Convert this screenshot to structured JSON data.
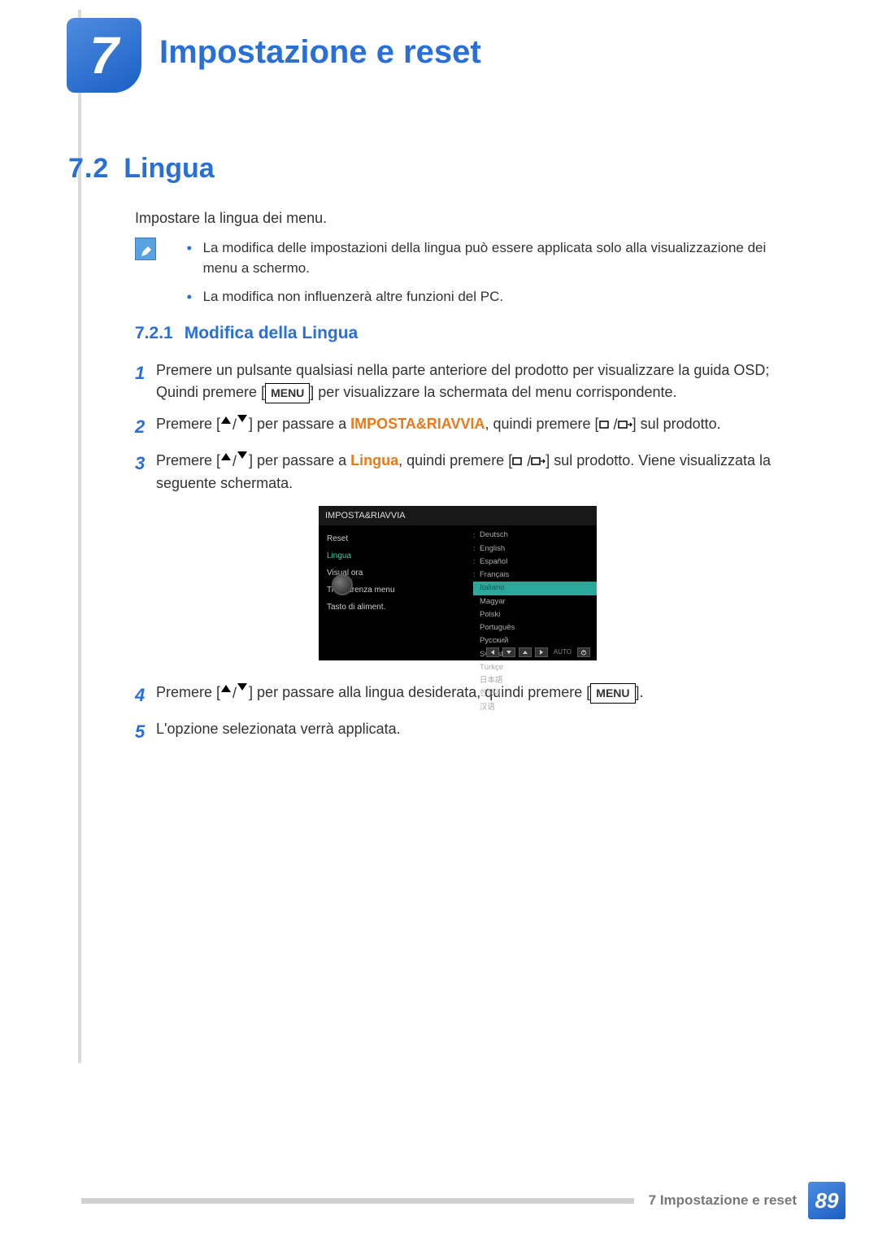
{
  "chapter": {
    "number": "7",
    "title": "Impostazione e reset"
  },
  "section": {
    "number": "7.2",
    "title": "Lingua"
  },
  "intro": "Impostare la lingua dei menu.",
  "notes": [
    "La modifica delle impostazioni della lingua può essere applicata solo alla visualizzazione dei menu a schermo.",
    "La modifica non influenzerà altre funzioni del PC."
  ],
  "subsection": {
    "number": "7.2.1",
    "title": "Modifica della Lingua"
  },
  "steps": {
    "s1a": "Premere un pulsante qualsiasi nella parte anteriore del prodotto per visualizzare la guida OSD; Quindi premere [",
    "s1b": "] per visualizzare la schermata del menu corrispondente.",
    "s2a": "Premere [",
    "s2b": "] per passare a ",
    "s2c": ", quindi premere [",
    "s2d": "] sul prodotto.",
    "s2orange": "IMPOSTA&RIAVVIA",
    "s3a": "Premere [",
    "s3b": "] per passare a ",
    "s3c": ", quindi premere [",
    "s3d": "] sul prodotto. Viene visualizzata la seguente schermata.",
    "s3orange": "Lingua",
    "s4a": "Premere [",
    "s4b": "] per passare alla lingua desiderata, quindi premere [",
    "s4c": "].",
    "s5": "L'opzione selezionata verrà applicata.",
    "menu_label": "MENU"
  },
  "osd": {
    "header": "IMPOSTA&RIAVVIA",
    "left_items": [
      "Reset",
      "Lingua",
      "Visual ora",
      "Trasparenza menu",
      "Tasto di aliment."
    ],
    "active_index": 1,
    "languages": [
      "Deutsch",
      "English",
      "Español",
      "Français",
      "Italiano",
      "Magyar",
      "Polski",
      "Português",
      "Русский",
      "Svenska",
      "Türkçe",
      "日本語",
      "한국어",
      "汉语"
    ],
    "highlighted_index": 4,
    "auto": "AUTO"
  },
  "footer": {
    "text": "7 Impostazione e reset",
    "page": "89"
  }
}
